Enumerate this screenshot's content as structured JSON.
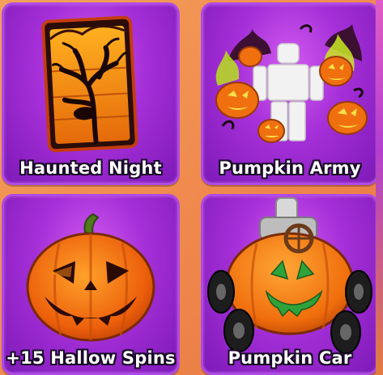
{
  "items": [
    {
      "label": "Haunted Night"
    },
    {
      "label": "Pumpkin Army"
    },
    {
      "label": "+15 Hallow Spins"
    },
    {
      "label": "Pumpkin Car"
    }
  ],
  "colors": {
    "card_purple": "#a52fd8",
    "pumpkin_orange": "#f07a10",
    "background_orange": "#f08a4e",
    "label_outline": "#1b0a2a"
  }
}
